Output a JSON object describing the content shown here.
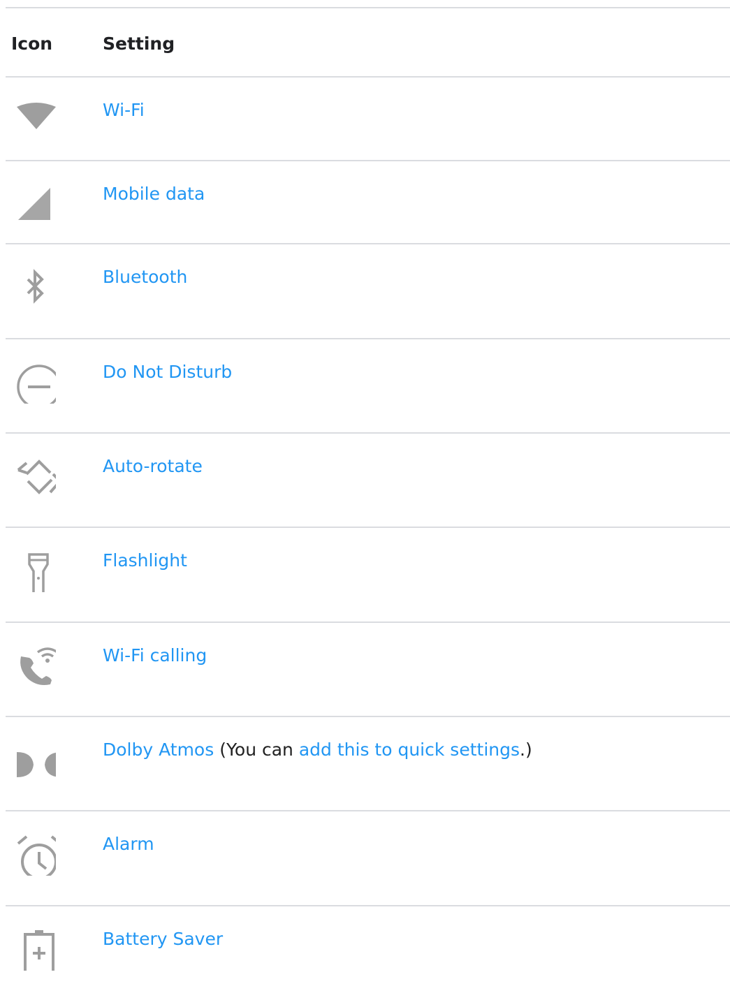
{
  "header": {
    "icon_col": "Icon",
    "setting_col": "Setting"
  },
  "rows": [
    {
      "icon": "wifi-icon",
      "link": "Wi-Fi"
    },
    {
      "icon": "mobile-data-icon",
      "link": "Mobile data"
    },
    {
      "icon": "bluetooth-icon",
      "link": "Bluetooth"
    },
    {
      "icon": "do-not-disturb-icon",
      "link": "Do Not Disturb"
    },
    {
      "icon": "auto-rotate-icon",
      "link": "Auto-rotate"
    },
    {
      "icon": "flashlight-icon",
      "link": "Flashlight"
    },
    {
      "icon": "wifi-calling-icon",
      "link": "Wi-Fi calling"
    },
    {
      "icon": "dolby-atmos-icon",
      "link": "Dolby Atmos",
      "note_prefix": " (You can ",
      "note_link": "add this to quick settings",
      "note_suffix": ".)"
    },
    {
      "icon": "alarm-icon",
      "link": "Alarm"
    },
    {
      "icon": "battery-saver-icon",
      "link": "Battery Saver"
    }
  ],
  "colors": {
    "link": "#2196f3",
    "icon": "#9e9e9e",
    "divider": "#dadce0"
  }
}
